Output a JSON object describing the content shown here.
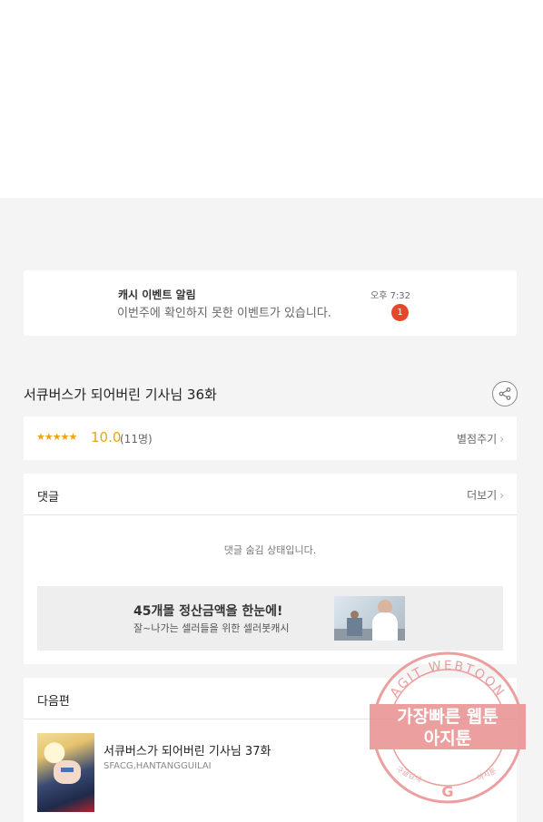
{
  "notification": {
    "title": "캐시 이벤트 알림",
    "message": "이번주에 확인하지 못한 이벤트가 있습니다.",
    "time": "오후 7:32",
    "badge_count": "1"
  },
  "episode": {
    "title": "서큐버스가 되어버린 기사님 36화",
    "share_icon": "share-icon"
  },
  "rating": {
    "stars": "★★★★★",
    "score": "10.0",
    "count": "(11명)",
    "rate_label": "별점주기"
  },
  "comments": {
    "header": "댓글",
    "more_label": "더보기",
    "hidden_message": "댓글 숨김 상태입니다."
  },
  "ad": {
    "title": "45개몰 정산금액을 한눈에!",
    "subtitle": "잘~나가는 셀러들을 위한 셀러봇캐시"
  },
  "next_episode": {
    "header": "다음편",
    "title": "서큐버스가 되어버린 기사님 37화",
    "author": "SFACG,HANTANGGUILAI"
  },
  "watermark": {
    "ring_text": "AGIT WEBTOON",
    "line1": "가장빠른 웹툰",
    "line2": "아지툰",
    "bottom_left": "구글검색",
    "bottom_right": "아지툰"
  },
  "colors": {
    "accent": "#f0a20e",
    "badge": "#e4472b",
    "stamp": "#e88a8a"
  }
}
